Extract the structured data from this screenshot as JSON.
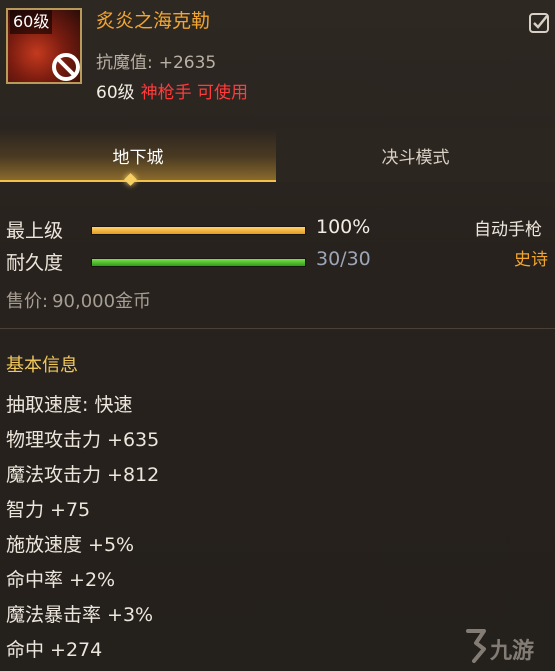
{
  "header": {
    "level_badge": "60级",
    "item_name": "炙炎之海克勒",
    "resist_label": "抗魔值:",
    "resist_value": "+2635",
    "req_level": "60级",
    "req_class": "神枪手 可使用"
  },
  "tabs": [
    {
      "label": "地下城",
      "active": true
    },
    {
      "label": "决斗模式",
      "active": false
    }
  ],
  "bars": {
    "grade": {
      "label": "最上级",
      "value": "100%",
      "fraction": 1.0
    },
    "durability": {
      "label": "耐久度",
      "value": "30/30",
      "fraction": 1.0
    }
  },
  "item_type": "自动手枪",
  "rarity": "史诗",
  "price": {
    "label": "售价:",
    "value": "90,000金币"
  },
  "section_title": "基本信息",
  "stats": [
    "抽取速度: 快速",
    "物理攻击力 +635",
    "魔法攻击力 +812",
    "智力 +75",
    "施放速度 +5%",
    "命中率 +2%",
    "魔法暴击率 +3%",
    "命中 +274"
  ],
  "watermark": "九游",
  "colors": {
    "name_orange": "#f2a531",
    "class_red": "#ff3b3b",
    "section_gold": "#f0c85a",
    "bar_gold": "#e59b1e",
    "bar_green": "#2f9c19"
  },
  "icons": [
    "item-icon",
    "no-entry-icon",
    "checkbox-icon",
    "tab-diamond-icon",
    "watermark-logo-icon"
  ]
}
